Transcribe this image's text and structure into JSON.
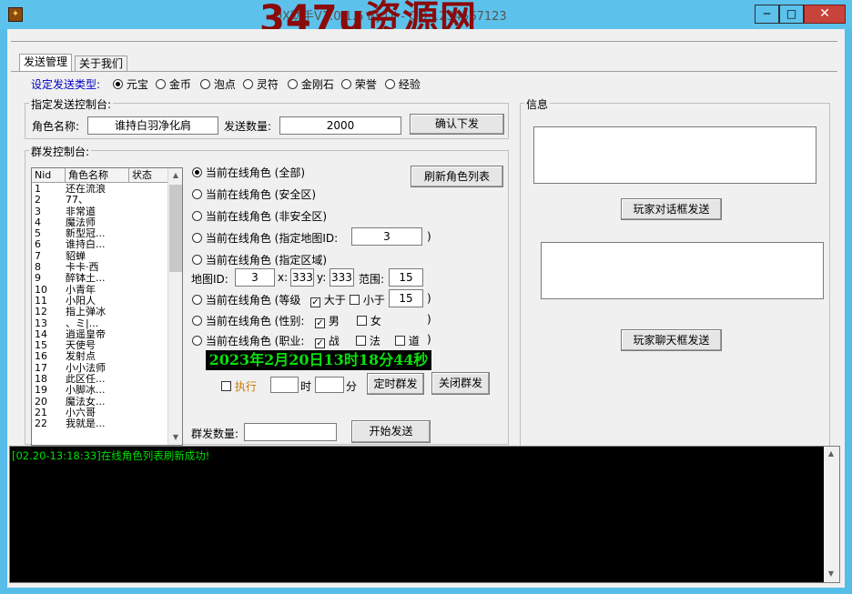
{
  "window": {
    "title": "DX助手V1.0.1.6 By.DJ - QQ:1234567123",
    "watermark": "347u资源网",
    "minimize": "─",
    "maximize": "□",
    "close": "✕",
    "app_icon": "✦"
  },
  "tabs": [
    {
      "label": "发送管理"
    },
    {
      "label": "关于我们"
    }
  ],
  "send_type": {
    "label": "设定发送类型:",
    "options": [
      "元宝",
      "金币",
      "泡点",
      "灵符",
      "金刚石",
      "荣誉",
      "经验"
    ],
    "selected": 0
  },
  "single": {
    "group_label": "指定发送控制台:",
    "role_label": "角色名称:",
    "role_value": "谁持白羽净化肩",
    "count_label": "发送数量:",
    "count_value": "2000",
    "confirm_button": "确认下发"
  },
  "mass": {
    "group_label": "群发控制台:",
    "list": {
      "headers": [
        "Nid",
        "角色名称",
        "状态"
      ],
      "rows": [
        [
          "1",
          "还在流浪"
        ],
        [
          "2",
          "77、"
        ],
        [
          "3",
          "非常道"
        ],
        [
          "4",
          "魔法师"
        ],
        [
          "5",
          "新型冠..."
        ],
        [
          "6",
          "谁持白..."
        ],
        [
          "7",
          "貂蝉"
        ],
        [
          "8",
          "卡卡·西"
        ],
        [
          "9",
          "醉钵土..."
        ],
        [
          "10",
          "小青年"
        ],
        [
          "11",
          "小阳人"
        ],
        [
          "12",
          "指上弹冰"
        ],
        [
          "13",
          "、ミ|..."
        ],
        [
          "14",
          "逍遥皇帝"
        ],
        [
          "15",
          "天使号"
        ],
        [
          "16",
          "发射点"
        ],
        [
          "17",
          "小小法师"
        ],
        [
          "18",
          "此区任..."
        ],
        [
          "19",
          "小脚冰..."
        ],
        [
          "20",
          "魔法女..."
        ],
        [
          "21",
          "小六哥"
        ],
        [
          "22",
          "我就是..."
        ]
      ]
    },
    "refresh_button": "刷新角色列表",
    "opt_all": "当前在线角色 (全部)",
    "opt_safe": "当前在线角色 (安全区)",
    "opt_unsafe": "当前在线角色 (非安全区)",
    "opt_map": "当前在线角色 (指定地图ID:",
    "opt_map_value": "3",
    "opt_map_close": ")",
    "opt_area": "当前在线角色 (指定区域)",
    "area_map_label": "地图ID:",
    "area_map_value": "3",
    "area_x_label": "x:",
    "area_x_value": "333",
    "area_y_label": "y:",
    "area_y_value": "333",
    "area_range_label": "范围:",
    "area_range_value": "15",
    "opt_level": "当前在线角色 (等级",
    "level_gt": "大于",
    "level_lt": "小于",
    "level_value": "15",
    "level_close": ")",
    "opt_gender": "当前在线角色 (性别:",
    "gender_male": "男",
    "gender_female": "女",
    "gender_close": ")",
    "opt_job": "当前在线角色 (职业:",
    "job_warrior": "战",
    "job_mage": "法",
    "job_taoist": "道",
    "job_close": ")",
    "datetime": "2023年2月20日13时18分44秒",
    "exec_label": "执行",
    "hour_label": "时",
    "minute_label": "分",
    "timed_button": "定时群发",
    "close_button": "关闭群发",
    "count_label": "群发数量:",
    "count_value": "",
    "start_button": "开始发送"
  },
  "info": {
    "group_label": "信息",
    "dialog_button": "玩家对话框发送",
    "chat_button": "玩家聊天框发送"
  },
  "log": {
    "line": "[02.20-13:18:33]在线角色列表刷新成功!"
  },
  "colors": {
    "title_bar": "#5cc2ec",
    "close_button": "#c8433a",
    "accent_blue": "#0000c8",
    "log_text": "#00e000",
    "datetime_text": "#0be00b",
    "watermark": "#8b0a0a"
  }
}
